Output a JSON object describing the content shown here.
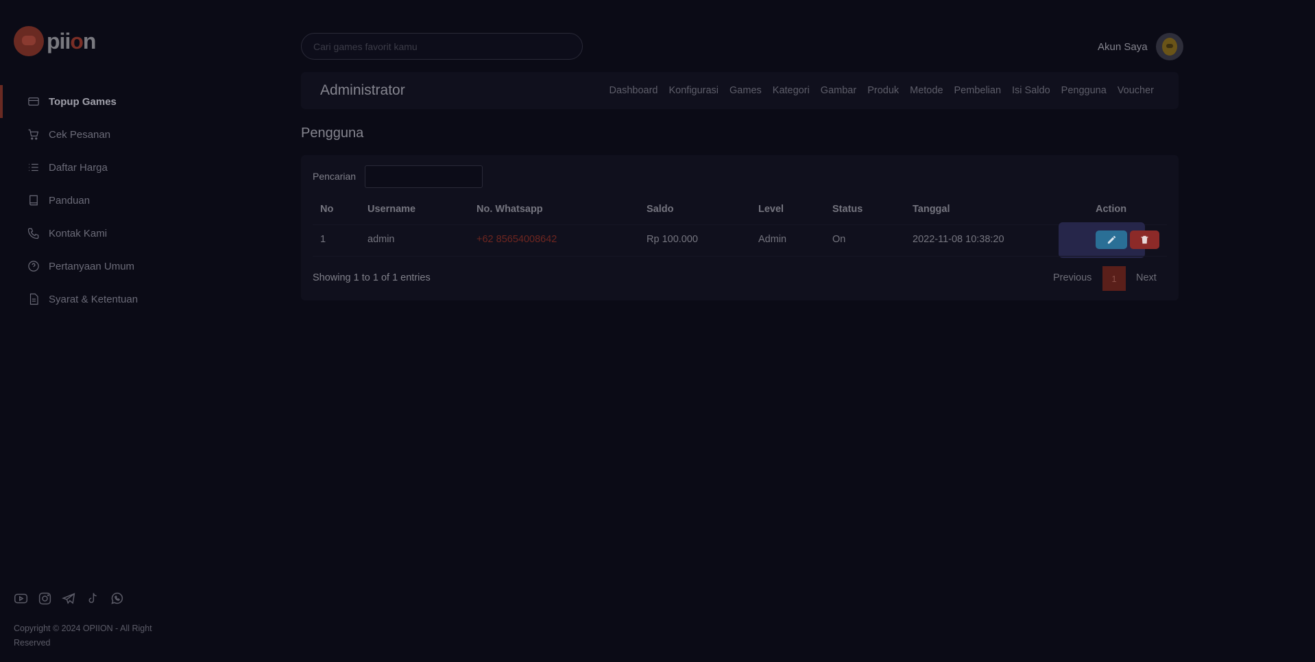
{
  "brand": {
    "logo_text_pre": "pii",
    "logo_text_o": "o",
    "logo_text_post": "n"
  },
  "sidebar": {
    "items": [
      {
        "label": "Topup Games",
        "icon": "card-icon",
        "active": true
      },
      {
        "label": "Cek Pesanan",
        "icon": "cart-icon",
        "active": false
      },
      {
        "label": "Daftar Harga",
        "icon": "list-icon",
        "active": false
      },
      {
        "label": "Panduan",
        "icon": "book-icon",
        "active": false
      },
      {
        "label": "Kontak Kami",
        "icon": "phone-icon",
        "active": false
      },
      {
        "label": "Pertanyaan Umum",
        "icon": "help-circle-icon",
        "active": false
      },
      {
        "label": "Syarat & Ketentuan",
        "icon": "document-icon",
        "active": false
      }
    ],
    "socials": [
      "youtube-icon",
      "instagram-icon",
      "telegram-icon",
      "tiktok-icon",
      "whatsapp-icon"
    ],
    "copyright": "Copyright © 2024 OPIION - All Right Reserved"
  },
  "topbar": {
    "search_placeholder": "Cari games favorit kamu",
    "account_label": "Akun Saya"
  },
  "admin": {
    "title": "Administrator",
    "nav": [
      "Dashboard",
      "Konfigurasi",
      "Games",
      "Kategori",
      "Gambar",
      "Produk",
      "Metode",
      "Pembelian",
      "Isi Saldo",
      "Pengguna",
      "Voucher"
    ]
  },
  "page": {
    "title": "Pengguna"
  },
  "table": {
    "search_label": "Pencarian",
    "columns": [
      "No",
      "Username",
      "No. Whatsapp",
      "Saldo",
      "Level",
      "Status",
      "Tanggal",
      "Action"
    ],
    "rows": [
      {
        "no": "1",
        "username": "admin",
        "whatsapp": "+62 85654008642",
        "saldo": "Rp 100.000",
        "level": "Admin",
        "status": "On",
        "tanggal": "2022-11-08 10:38:20"
      }
    ],
    "info": "Showing 1 to 1 of 1 entries",
    "pagination": {
      "previous": "Previous",
      "current": "1",
      "next": "Next"
    }
  },
  "colors": {
    "background": "#0b0b16",
    "accent": "#6a2a22",
    "edit": "#2a6f96",
    "delete": "#8c2a28"
  }
}
